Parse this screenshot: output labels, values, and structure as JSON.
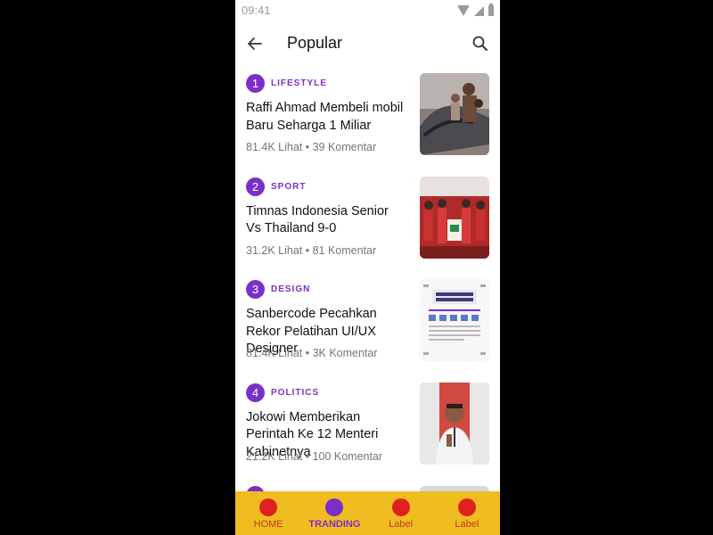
{
  "status_bar": {
    "time": "09:41"
  },
  "app_bar": {
    "title": "Popular"
  },
  "icons": {
    "back": "arrow-left-icon",
    "search": "search-icon",
    "wifi": "wifi-icon",
    "signal": "signal-icon",
    "battery": "battery-icon"
  },
  "colors": {
    "accent": "#7b2fc9",
    "nav_background": "#f0bd20",
    "nav_inactive": "#e02020",
    "meta_text": "#757575"
  },
  "news": [
    {
      "rank": "1",
      "category": "LIFESTYLE",
      "headline": "Raffi Ahmad Membeli mobil Baru Seharga 1 Miliar",
      "meta": "81.4K Lihat • 39 Komentar"
    },
    {
      "rank": "2",
      "category": "SPORT",
      "headline": "Timnas Indonesia Senior Vs Thailand 9-0",
      "meta": "31.2K Lihat • 81 Komentar"
    },
    {
      "rank": "3",
      "category": "DESIGN",
      "headline": "Sanbercode Pecahkan Rekor Pelatihan UI/UX Designer",
      "meta": "81.4K Lihat • 3K Komentar"
    },
    {
      "rank": "4",
      "category": "POLITICS",
      "headline": "Jokowi Memberikan Perintah Ke 12 Menteri Kabinetnya",
      "meta": "21.2K Lihat • 100 Komentar"
    }
  ],
  "bottom_nav": [
    {
      "label": "HOME",
      "active": false
    },
    {
      "label": "TRANDING",
      "active": true
    },
    {
      "label": "Label",
      "active": false
    },
    {
      "label": "Label",
      "active": false
    }
  ]
}
